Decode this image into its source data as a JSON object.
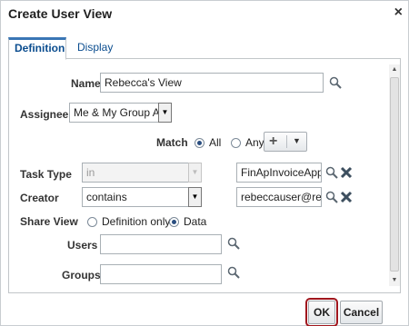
{
  "dialog": {
    "title": "Create User View",
    "close_label": "×"
  },
  "tabs": [
    {
      "label": "Definition"
    },
    {
      "label": "Display"
    }
  ],
  "form": {
    "name": {
      "label": "Name",
      "value": "Rebecca's View"
    },
    "assignee": {
      "label": "Assignee",
      "value": "Me & My Group All"
    },
    "match": {
      "label": "Match",
      "options": [
        "All",
        "Any"
      ],
      "selected": "All"
    },
    "task_type": {
      "label": "Task Type",
      "operator": "in",
      "value": "FinApInvoiceApproval"
    },
    "creator": {
      "label": "Creator",
      "operator": "contains",
      "value": "rebeccauser@remingt"
    },
    "share_view": {
      "label": "Share View",
      "options": [
        "Definition only",
        "Data"
      ],
      "selected": "Data"
    },
    "users": {
      "label": "Users",
      "value": ""
    },
    "groups": {
      "label": "Groups",
      "value": ""
    }
  },
  "buttons": {
    "ok": "OK",
    "cancel": "Cancel"
  },
  "colors": {
    "accent": "#3a76b5",
    "link": "#0b4d8f",
    "highlight": "#a0161d",
    "remove": "#3d4f5f"
  },
  "icons": [
    "close-icon",
    "search-icon",
    "remove-icon",
    "add-icon",
    "chevron-down-icon"
  ]
}
